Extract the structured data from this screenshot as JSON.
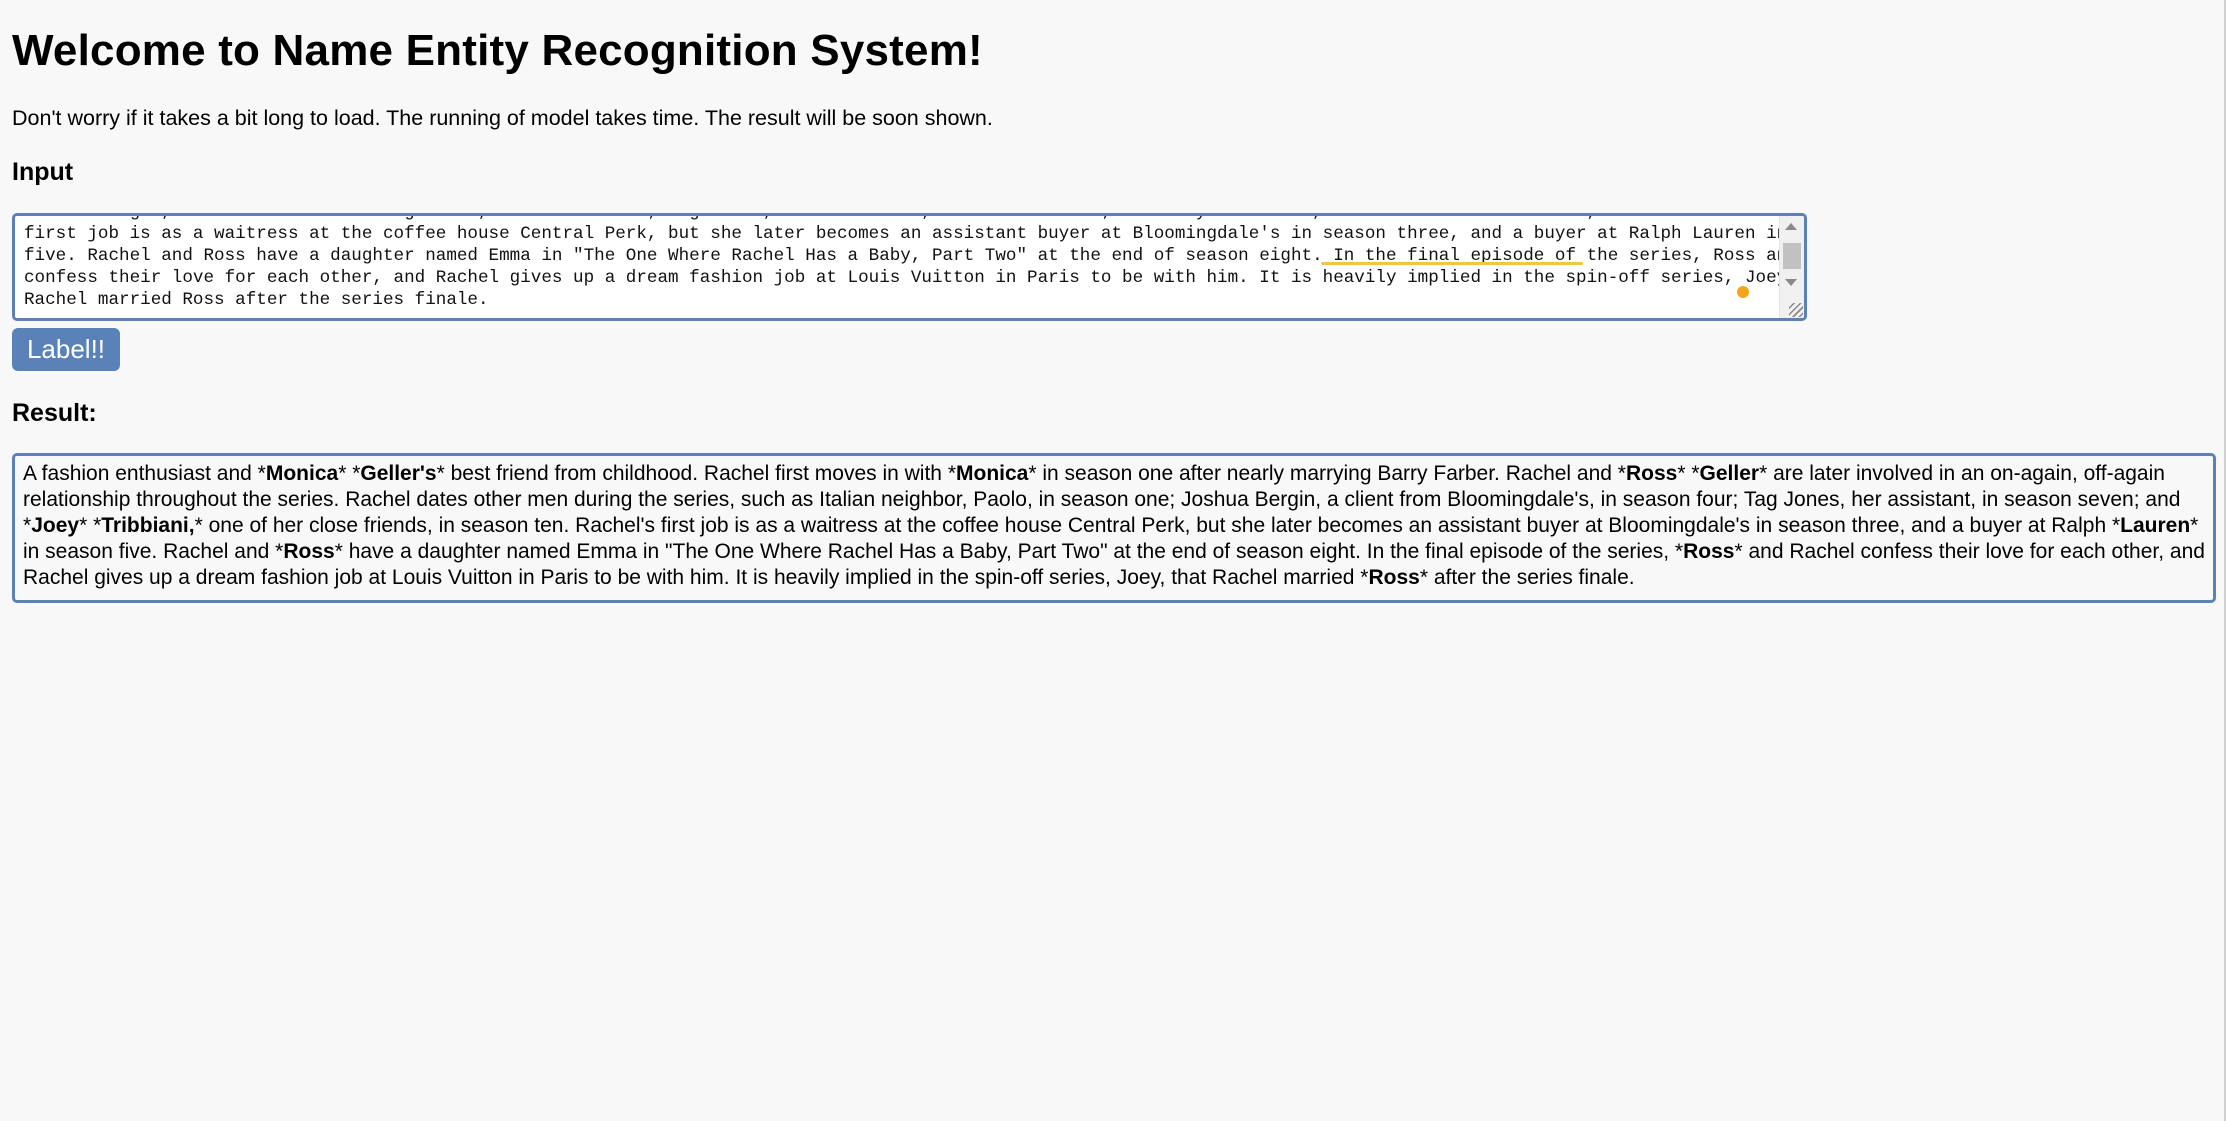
{
  "page": {
    "title": "Welcome to Name Entity Recognition System!",
    "subtitle": "Don't worry if it takes a bit long to load. The running of model takes time. The result will be soon shown."
  },
  "input": {
    "heading": "Input",
    "visible_lines": [
      "Joshua Bergin, a client from Bloomingdale's, in season four; Tag Jones, her assistant, in season seven; and Joey Tribbiani, one of her close friends, in season ten. Rachel's",
      "first job is as a waitress at the coffee house Central Perk, but she later becomes an assistant buyer at Bloomingdale's in season three, and a buyer at Ralph Lauren in season",
      "five. Rachel and Ross have a daughter named Emma in \"The One Where Rachel Has a Baby, Part Two\" at the end of season eight. In the final episode of the series, Ross and Rachel",
      "confess their love for each other, and Rachel gives up a dream fashion job at Louis Vuitton in Paris to be with him. It is heavily implied in the spin-off series, Joey, that",
      "Rachel married Ross after the series finale."
    ]
  },
  "button": {
    "label": "Label!!"
  },
  "result": {
    "heading": "Result:",
    "segments": [
      {
        "t": "A fashion enthusiast and *"
      },
      {
        "t": "Monica",
        "b": true
      },
      {
        "t": "* *"
      },
      {
        "t": "Geller's",
        "b": true
      },
      {
        "t": "* best friend from childhood. Rachel first moves in with *"
      },
      {
        "t": "Monica",
        "b": true
      },
      {
        "t": "* in season one after nearly marrying Barry Farber. Rachel and *"
      },
      {
        "t": "Ross",
        "b": true
      },
      {
        "t": "* *"
      },
      {
        "t": "Geller",
        "b": true
      },
      {
        "t": "* are later involved in an on-again, off-again relationship throughout the series. Rachel dates other men during the series, such as Italian neighbor, Paolo, in season one; Joshua Bergin, a client from Bloomingdale's, in season four; Tag Jones, her assistant, in season seven; and *"
      },
      {
        "t": "Joey",
        "b": true
      },
      {
        "t": "* *"
      },
      {
        "t": "Tribbiani,",
        "b": true
      },
      {
        "t": "* one of her close friends, in season ten. Rachel's first job is as a waitress at the coffee house Central Perk, but she later becomes an assistant buyer at Bloomingdale's in season three, and a buyer at Ralph *"
      },
      {
        "t": "Lauren",
        "b": true
      },
      {
        "t": "* in season five. Rachel and *"
      },
      {
        "t": "Ross",
        "b": true
      },
      {
        "t": "* have a daughter named Emma in \"The One Where Rachel Has a Baby, Part Two\" at the end of season eight. In the final episode of the series, *"
      },
      {
        "t": "Ross",
        "b": true
      },
      {
        "t": "* and Rachel confess their love for each other, and Rachel gives up a dream fashion job at Louis Vuitton in Paris to be with him. It is heavily implied in the spin-off series, Joey, that Rachel married *"
      },
      {
        "t": "Ross",
        "b": true
      },
      {
        "t": "* after the series finale."
      }
    ]
  },
  "colors": {
    "accent": "#5b82b8",
    "background": "#f8f8f8",
    "grammar": "#f2a51a"
  }
}
